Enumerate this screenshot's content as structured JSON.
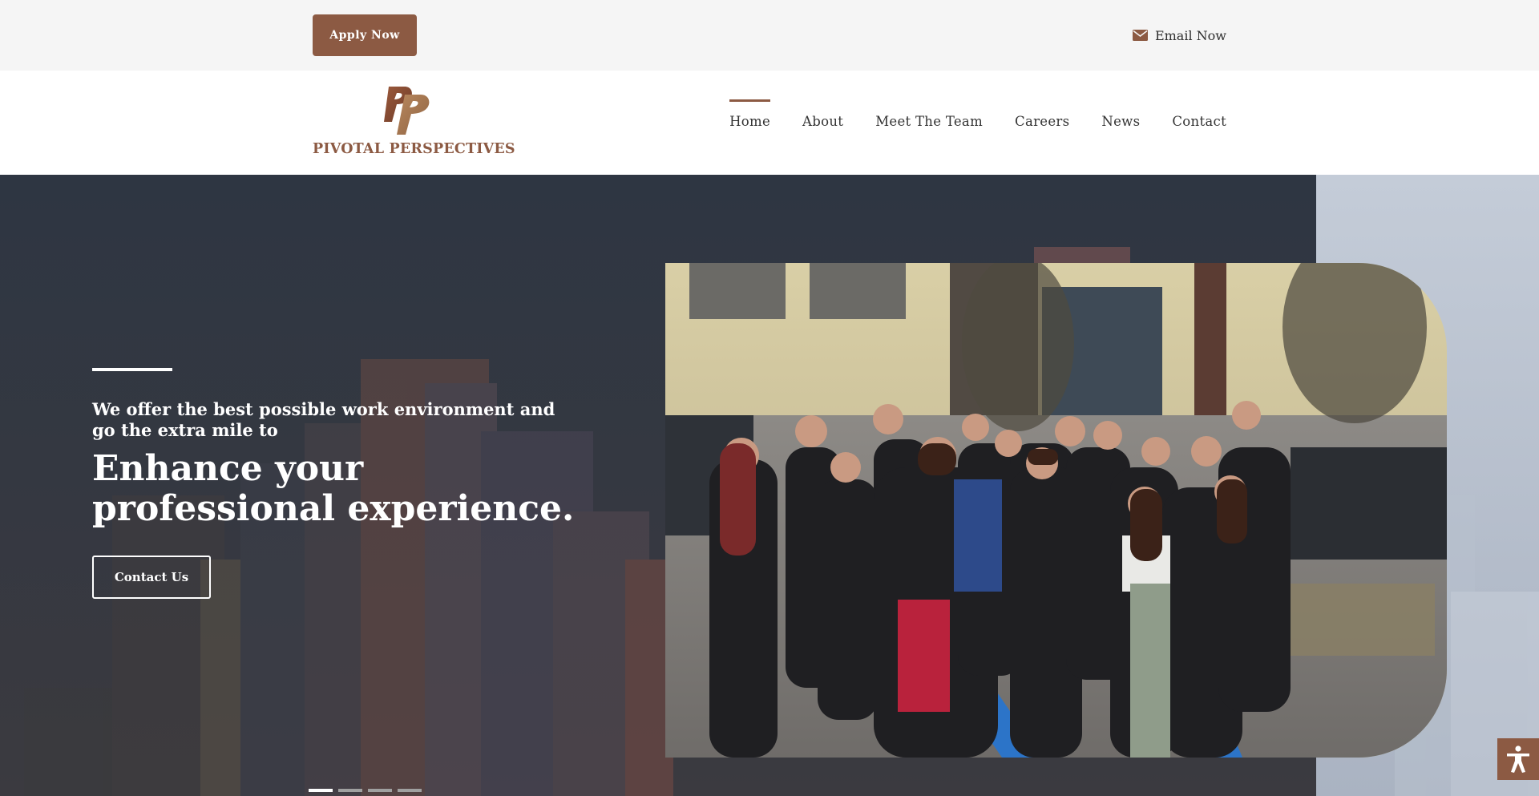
{
  "topbar": {
    "apply_label": "Apply Now",
    "email_label": "Email Now",
    "email_icon": "envelope-icon"
  },
  "header": {
    "brand_name": "PIVOTAL PERSPECTIVES",
    "nav": [
      {
        "label": "Home",
        "active": true
      },
      {
        "label": "About",
        "active": false
      },
      {
        "label": "Meet The Team",
        "active": false
      },
      {
        "label": "Careers",
        "active": false
      },
      {
        "label": "News",
        "active": false
      },
      {
        "label": "Contact",
        "active": false
      }
    ]
  },
  "hero": {
    "subtitle": "We offer the best possible work environment and go the extra mile to",
    "title": "Enhance your professional experience.",
    "cta_label": "Contact Us",
    "slides_total": 4,
    "active_slide": 1
  },
  "accessibility": {
    "icon": "accessibility-icon"
  },
  "colors": {
    "brand": "#8c5a43",
    "topbar_bg": "#f5f5f5",
    "hero_overlay": "#2c3440"
  }
}
